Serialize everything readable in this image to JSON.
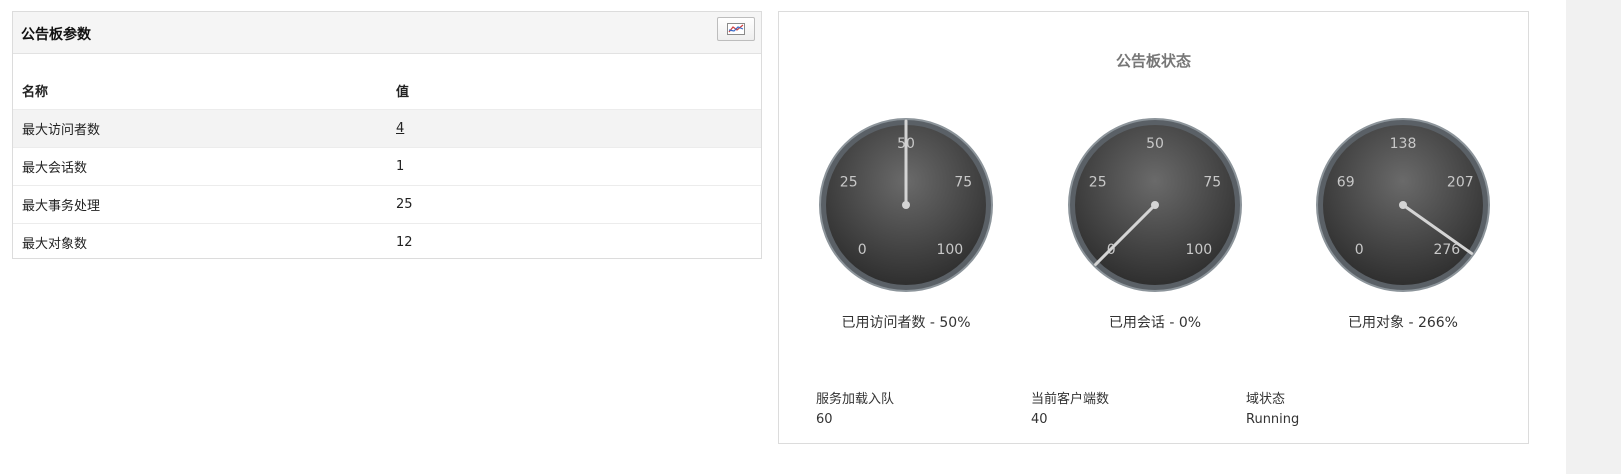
{
  "board_params": {
    "title": "公告板参数",
    "chart_button_icon": "chart-icon",
    "columns": [
      "名称",
      "值"
    ],
    "rows": [
      {
        "name": "最大访问者数",
        "value": "4"
      },
      {
        "name": "最大会话数",
        "value": "1"
      },
      {
        "name": "最大事务处理",
        "value": "25"
      },
      {
        "name": "最大对象数",
        "value": "12"
      }
    ]
  },
  "board_status": {
    "title": "公告板状态",
    "gauges": [
      {
        "label": "已用访问者数 - 50%",
        "ticks": [
          "0",
          "25",
          "50",
          "75",
          "100"
        ],
        "max": 100,
        "value": 50
      },
      {
        "label": "已用会话 - 0%",
        "ticks": [
          "0",
          "25",
          "50",
          "75",
          "100"
        ],
        "max": 100,
        "value": 0
      },
      {
        "label": "已用对象 - 266%",
        "ticks": [
          "0",
          "69",
          "138",
          "207",
          "276"
        ],
        "max": 276,
        "value": 266
      }
    ],
    "stats": [
      {
        "label": "服务加载入队",
        "value": "60"
      },
      {
        "label": "当前客户端数",
        "value": "40"
      },
      {
        "label": "域状态",
        "value": "Running"
      }
    ]
  }
}
